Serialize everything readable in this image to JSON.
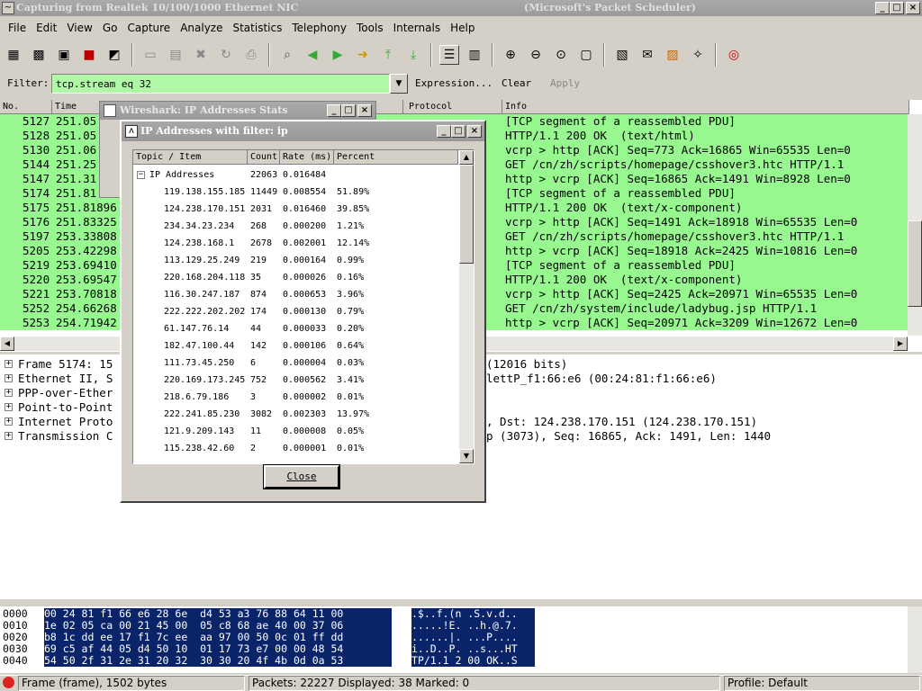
{
  "window": {
    "title": "Capturing from Realtek 10/100/1000 Ethernet NIC",
    "title_suffix": "(Microsoft's Packet Scheduler)"
  },
  "menu": [
    "File",
    "Edit",
    "View",
    "Go",
    "Capture",
    "Analyze",
    "Statistics",
    "Telephony",
    "Tools",
    "Internals",
    "Help"
  ],
  "filter": {
    "label": "Filter:",
    "value": "tcp.stream eq 32",
    "expression": "Expression...",
    "clear": "Clear",
    "apply": "Apply"
  },
  "columns": {
    "no": "No.",
    "time": "Time",
    "protocol": "Protocol",
    "info": "Info"
  },
  "packets": [
    {
      "no": "5127",
      "time": "251.05",
      "info": "[TCP segment of a reassembled PDU]"
    },
    {
      "no": "5128",
      "time": "251.05",
      "info": "HTTP/1.1 200 OK  (text/html)"
    },
    {
      "no": "5130",
      "time": "251.06",
      "info": "vcrp > http [ACK] Seq=773 Ack=16865 Win=65535 Len=0"
    },
    {
      "no": "5144",
      "time": "251.25",
      "info": "GET /cn/zh/scripts/homepage/csshover3.htc HTTP/1.1"
    },
    {
      "no": "5147",
      "time": "251.31",
      "info": "http > vcrp [ACK] Seq=16865 Ack=1491 Win=8928 Len=0"
    },
    {
      "no": "5174",
      "time": "251.81",
      "info": "[TCP segment of a reassembled PDU]"
    },
    {
      "no": "5175",
      "time": "251.81896",
      "info": "HTTP/1.1 200 OK  (text/x-component)"
    },
    {
      "no": "5176",
      "time": "251.83325",
      "info": "vcrp > http [ACK] Seq=1491 Ack=18918 Win=65535 Len=0"
    },
    {
      "no": "5197",
      "time": "253.33808",
      "info": "GET /cn/zh/scripts/homepage/csshover3.htc HTTP/1.1"
    },
    {
      "no": "5205",
      "time": "253.42298",
      "info": "http > vcrp [ACK] Seq=18918 Ack=2425 Win=10816 Len=0"
    },
    {
      "no": "5219",
      "time": "253.69410",
      "info": "[TCP segment of a reassembled PDU]"
    },
    {
      "no": "5220",
      "time": "253.69547",
      "info": "HTTP/1.1 200 OK  (text/x-component)"
    },
    {
      "no": "5221",
      "time": "253.70818",
      "info": "vcrp > http [ACK] Seq=2425 Ack=20971 Win=65535 Len=0"
    },
    {
      "no": "5252",
      "time": "254.66268",
      "info": "GET /cn/zh/system/include/ladybug.jsp HTTP/1.1"
    },
    {
      "no": "5253",
      "time": "254.71942",
      "info": "http > vcrp [ACK] Seq=20971 Ack=3209 Win=12672 Len=0"
    }
  ],
  "details": [
    {
      "left": "Frame 5174: 15",
      "right": "(12016 bits)"
    },
    {
      "left": "Ethernet II, S",
      "right": "lettP_f1:66:e6 (00:24:81:f1:66:e6)"
    },
    {
      "left": "PPP-over-Ether",
      "right": ""
    },
    {
      "left": "Point-to-Point",
      "right": ""
    },
    {
      "left": "Internet Proto",
      "right": ", Dst: 124.238.170.151 (124.238.170.151)"
    },
    {
      "left": "Transmission C",
      "right": "p (3073), Seq: 16865, Ack: 1491, Len: 1440"
    }
  ],
  "hex_rows": [
    {
      "off": "0000",
      "hex": "00 24 81 f1 66 e6 28 6e  d4 53 a3 76 88 64 11 00",
      "ascii": ".$..f.(n .S.v.d.."
    },
    {
      "off": "0010",
      "hex": "1e 02 05 ca 00 21 45 00  05 c8 68 ae 40 00 37 06",
      "ascii": ".....!E. ..h.@.7."
    },
    {
      "off": "0020",
      "hex": "b8 1c dd ee 17 f1 7c ee  aa 97 00 50 0c 01 ff dd",
      "ascii": "......|. ...P...."
    },
    {
      "off": "0030",
      "hex": "69 c5 af 44 05 d4 50 10  01 17 73 e7 00 00 48 54",
      "ascii": "i..D..P. ..s...HT"
    },
    {
      "off": "0040",
      "hex": "54 50 2f 31 2e 31 20 32  30 30 20 4f 4b 0d 0a 53",
      "ascii": "TP/1.1 2 00 OK..S"
    }
  ],
  "status": {
    "frame": "Frame (frame), 1502 bytes",
    "packets": "Packets: 22227 Displayed: 38 Marked: 0",
    "profile": "Profile: Default"
  },
  "bg_dialog": {
    "title": "Wireshark: IP Addresses Stats"
  },
  "dialog": {
    "title": "IP Addresses with filter: ip",
    "headers": {
      "topic": "Topic / Item",
      "count": "Count",
      "rate": "Rate (ms)",
      "percent": "Percent"
    },
    "root": {
      "label": "IP Addresses",
      "count": "22063",
      "rate": "0.016484"
    },
    "items": [
      {
        "ip": "119.138.155.185",
        "count": "11449",
        "rate": "0.008554",
        "percent": "51.89%"
      },
      {
        "ip": "124.238.170.151",
        "count": "2031",
        "rate": "0.016460",
        "percent": "39.85%"
      },
      {
        "ip": "234.34.23.234",
        "count": "268",
        "rate": "0.000200",
        "percent": "1.21%"
      },
      {
        "ip": "124.238.168.1",
        "count": "2678",
        "rate": "0.002001",
        "percent": "12.14%"
      },
      {
        "ip": "113.129.25.249",
        "count": "219",
        "rate": "0.000164",
        "percent": "0.99%"
      },
      {
        "ip": "220.168.204.118",
        "count": "35",
        "rate": "0.000026",
        "percent": "0.16%"
      },
      {
        "ip": "116.30.247.187",
        "count": "874",
        "rate": "0.000653",
        "percent": "3.96%"
      },
      {
        "ip": "222.222.202.202",
        "count": "174",
        "rate": "0.000130",
        "percent": "0.79%"
      },
      {
        "ip": "61.147.76.14",
        "count": "44",
        "rate": "0.000033",
        "percent": "0.20%"
      },
      {
        "ip": "182.47.100.44",
        "count": "142",
        "rate": "0.000106",
        "percent": "0.64%"
      },
      {
        "ip": "111.73.45.250",
        "count": "6",
        "rate": "0.000004",
        "percent": "0.03%"
      },
      {
        "ip": "220.169.173.245",
        "count": "752",
        "rate": "0.000562",
        "percent": "3.41%"
      },
      {
        "ip": "218.6.79.186",
        "count": "3",
        "rate": "0.000002",
        "percent": "0.01%"
      },
      {
        "ip": "222.241.85.230",
        "count": "3082",
        "rate": "0.002303",
        "percent": "13.97%"
      },
      {
        "ip": "121.9.209.143",
        "count": "11",
        "rate": "0.000008",
        "percent": "0.05%"
      },
      {
        "ip": "115.238.42.60",
        "count": "2",
        "rate": "0.000001",
        "percent": "0.01%"
      }
    ],
    "close": "Close"
  }
}
